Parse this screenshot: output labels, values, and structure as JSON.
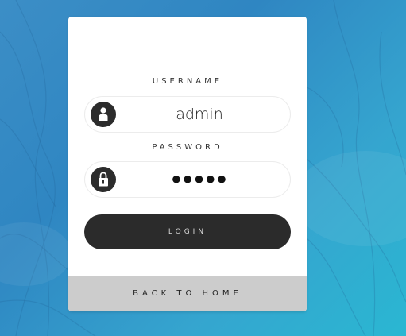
{
  "login_form": {
    "username": {
      "label": "USERNAME",
      "value": "admin",
      "icon": "user-icon"
    },
    "password": {
      "label": "PASSWORD",
      "masked_value": "●●●●●",
      "icon": "lock-icon"
    },
    "login_button_label": "LOGIN",
    "back_home_label": "BACK TO HOME"
  },
  "colors": {
    "background_gradient_start": "#3c8ec6",
    "background_gradient_end": "#2ab7d2",
    "card": "#ffffff",
    "button_dark": "#2b2b2b",
    "back_home_bar": "#cccccc"
  }
}
